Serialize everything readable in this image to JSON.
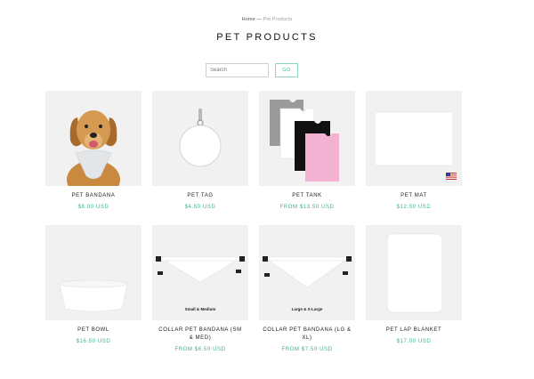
{
  "breadcrumb": {
    "home": "Home",
    "separator": " — ",
    "current": "Pet Products"
  },
  "page_title": "PET PRODUCTS",
  "search": {
    "placeholder": "Search",
    "value": "",
    "button_label": "GO"
  },
  "colors": {
    "accent": "#3fb28f",
    "thumb_bg": "#f1f1f1"
  },
  "products": [
    {
      "name": "PET BANDANA",
      "price": "$8.00 USD",
      "icon": "dog-bandana"
    },
    {
      "name": "PET TAG",
      "price": "$4.50 USD",
      "icon": "round-tag"
    },
    {
      "name": "PET TANK",
      "price": "FROM $13.50 USD",
      "icon": "pet-tanks"
    },
    {
      "name": "PET MAT",
      "price": "$12.50 USD",
      "icon": "pet-mat"
    },
    {
      "name": "PET BOWL",
      "price": "$16.50 USD",
      "icon": "pet-bowl"
    },
    {
      "name": "COLLAR PET BANDANA (SM & MED)",
      "price": "FROM $6.50 USD",
      "icon": "collar-bandana",
      "caption": "Small & Medium"
    },
    {
      "name": "COLLAR PET BANDANA (LG & XL)",
      "price": "FROM $7.50 USD",
      "icon": "collar-bandana",
      "caption": "Large & X-Large"
    },
    {
      "name": "PET LAP BLANKET",
      "price": "$17.00 USD",
      "icon": "lap-blanket"
    }
  ]
}
